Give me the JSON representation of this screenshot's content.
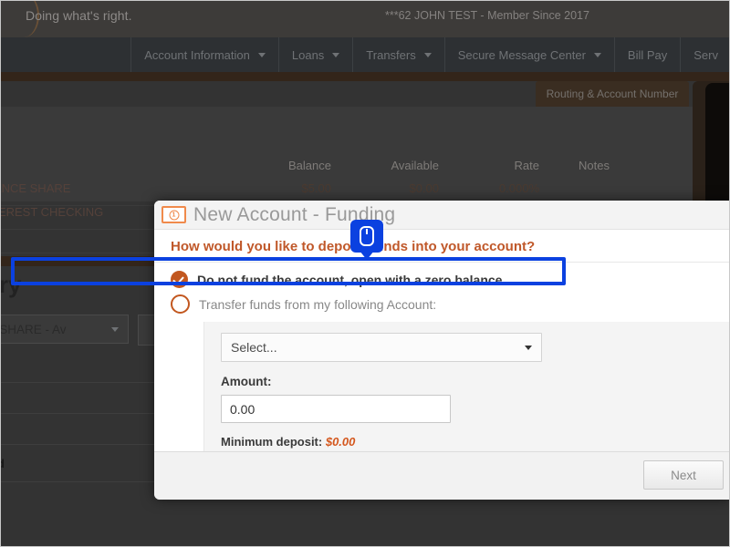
{
  "background": {
    "tagline": "Doing what's right.",
    "member_info": "***62 JOHN TEST - Member Since 2017",
    "nav_items": [
      {
        "label": "Account Information",
        "has_caret": true
      },
      {
        "label": "Loans",
        "has_caret": true
      },
      {
        "label": "Transfers",
        "has_caret": true
      },
      {
        "label": "Secure Message Center",
        "has_caret": true
      },
      {
        "label": "Bill Pay",
        "has_caret": false
      },
      {
        "label": "Serv",
        "has_caret": false
      }
    ],
    "tab_label": "Routing & Account Number",
    "table": {
      "headers": [
        "Balance",
        "Available",
        "Rate",
        "Notes"
      ],
      "rows": [
        {
          "account": "ALANCE SHARE",
          "balance": "$5.00",
          "available": "$0.00",
          "rate": "0.000%",
          "notes": ""
        },
        {
          "account": "INTEREST CHECKING",
          "balance": "",
          "available": "",
          "rate": "",
          "notes": ""
        }
      ]
    },
    "history_title": "ory",
    "history_select_value": "ANCE SHARE - Av",
    "small_text": "d"
  },
  "modal": {
    "icon": "money-banknote-icon",
    "title": "New Account - Funding",
    "question": "How would you like to deposit funds into your account?",
    "options": [
      {
        "label": "Do not fund the account, open with a zero balance.",
        "selected": true
      },
      {
        "label": "Transfer funds from my following Account:",
        "selected": false
      }
    ],
    "account_select": {
      "value": "Select...",
      "caret": "chevron-down-icon"
    },
    "amount": {
      "label": "Amount:",
      "value": "0.00"
    },
    "minimum_deposit": {
      "label": "Minimum deposit:",
      "value": "$0.00"
    },
    "footer": {
      "next_label": "Next"
    }
  },
  "annotation": {
    "highlight_color": "#0b41e0",
    "cursor_glyph": "mouse-pointer-icon"
  },
  "colors": {
    "accent_orange": "#c2571f",
    "heading_orange": "#c0582a",
    "highlight_blue": "#0b41e0",
    "modal_bg": "#ffffff",
    "backdrop": "#333333"
  }
}
